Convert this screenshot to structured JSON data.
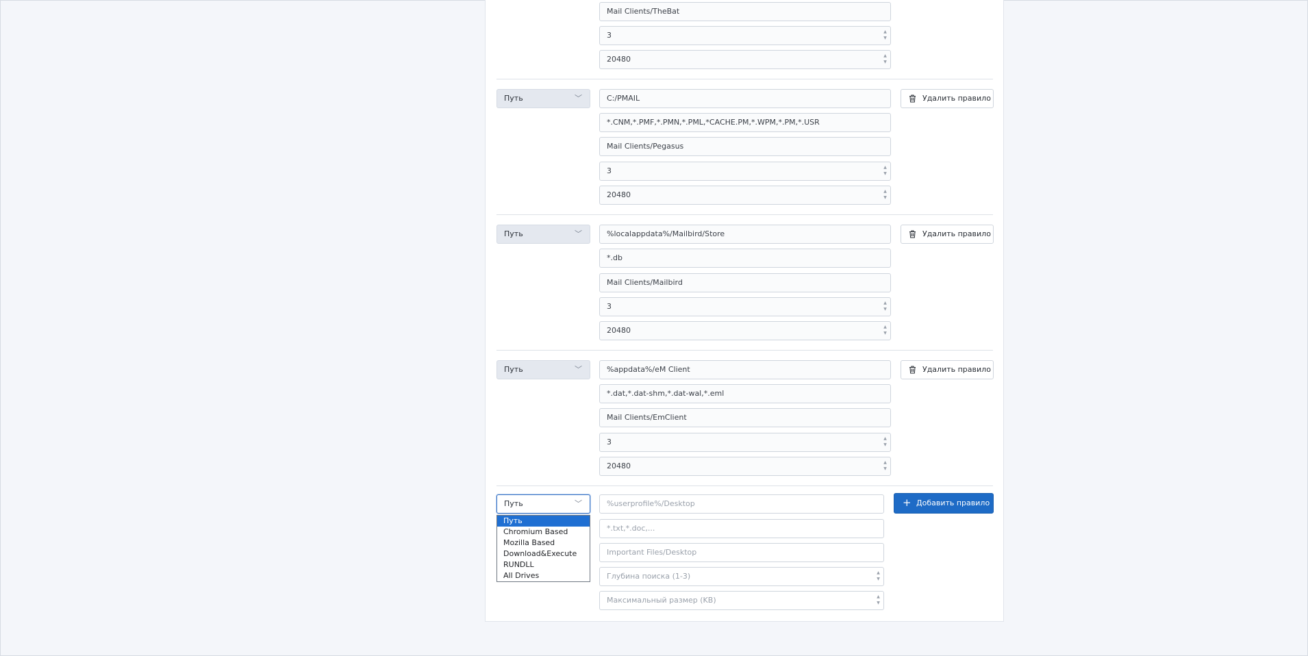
{
  "rule_partial": {
    "name": "Mail Clients/TheBat",
    "depth": "3",
    "max_size": "20480"
  },
  "rules": [
    {
      "type": "Путь",
      "path": "C:/PMAIL",
      "mask": "*.CNM,*.PMF,*.PMN,*.PML,*CACHE.PM,*.WPM,*.PM,*.USR",
      "name": "Mail Clients/Pegasus",
      "depth": "3",
      "max_size": "20480",
      "delete_label": "Удалить правило"
    },
    {
      "type": "Путь",
      "path": "%localappdata%/Mailbird/Store",
      "mask": "*.db",
      "name": "Mail Clients/Mailbird",
      "depth": "3",
      "max_size": "20480",
      "delete_label": "Удалить правило"
    },
    {
      "type": "Путь",
      "path": "%appdata%/eM Client",
      "mask": "*.dat,*.dat-shm,*.dat-wal,*.eml",
      "name": "Mail Clients/EmClient",
      "depth": "3",
      "max_size": "20480",
      "delete_label": "Удалить правило"
    }
  ],
  "new_rule": {
    "type": "Путь",
    "path_placeholder": "%userprofile%/Desktop",
    "mask_placeholder": "*.txt,*.doc,...",
    "name_placeholder": "Important Files/Desktop",
    "depth_placeholder": "Глубина поиска (1-3)",
    "max_size_placeholder": "Максимальный размер (KB)",
    "add_label": "Добавить правило"
  },
  "type_options": [
    "Путь",
    "Chromium Based",
    "Mozilla Based",
    "Download&Execute",
    "RUNDLL",
    "All Drives"
  ],
  "selected_option_index": 0,
  "icons": {
    "select_chevron": "chevron-down-icon",
    "delete": "trash-icon",
    "add": "plus-icon",
    "spinner": "spinner-arrows-icon"
  },
  "colors": {
    "primary": "#1e6bc6",
    "highlight": "#1f6fd2",
    "background": "#f4f6fa"
  }
}
